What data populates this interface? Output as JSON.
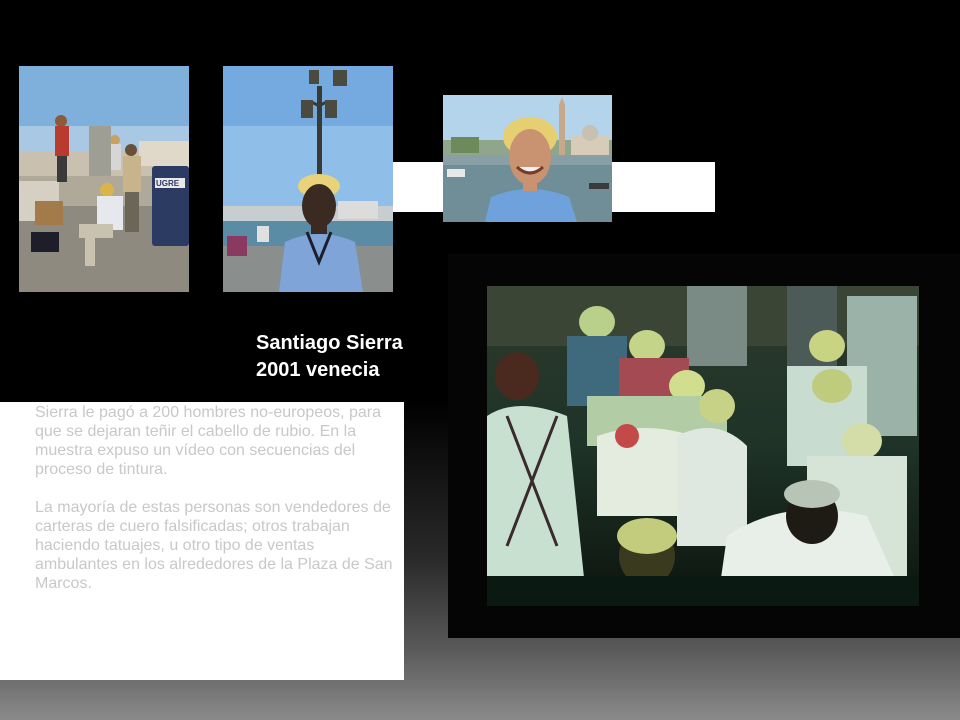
{
  "title": {
    "line1": "Santiago Sierra",
    "line2": "2001 venecia"
  },
  "description": {
    "paragraph1": "Sierra le pagó a 200 hombres no-europeos, para que se dejaran teñir el cabello de rubio. En la muestra expuso un vídeo con secuencias del proceso de tintura.",
    "paragraph2": "La mayoría de estas personas son vendedores de carteras de cuero falsificadas; otros trabajan haciendo tatuajes, u otro tipo de ventas ambulantes en los alrededores de la Plaza de San Marcos."
  },
  "photos": {
    "photo1_sign": "UGRE"
  },
  "colors": {
    "background": "#000000",
    "title_text": "#ffffff",
    "body_text": "#c8c8c8",
    "panel": "#ffffff"
  }
}
